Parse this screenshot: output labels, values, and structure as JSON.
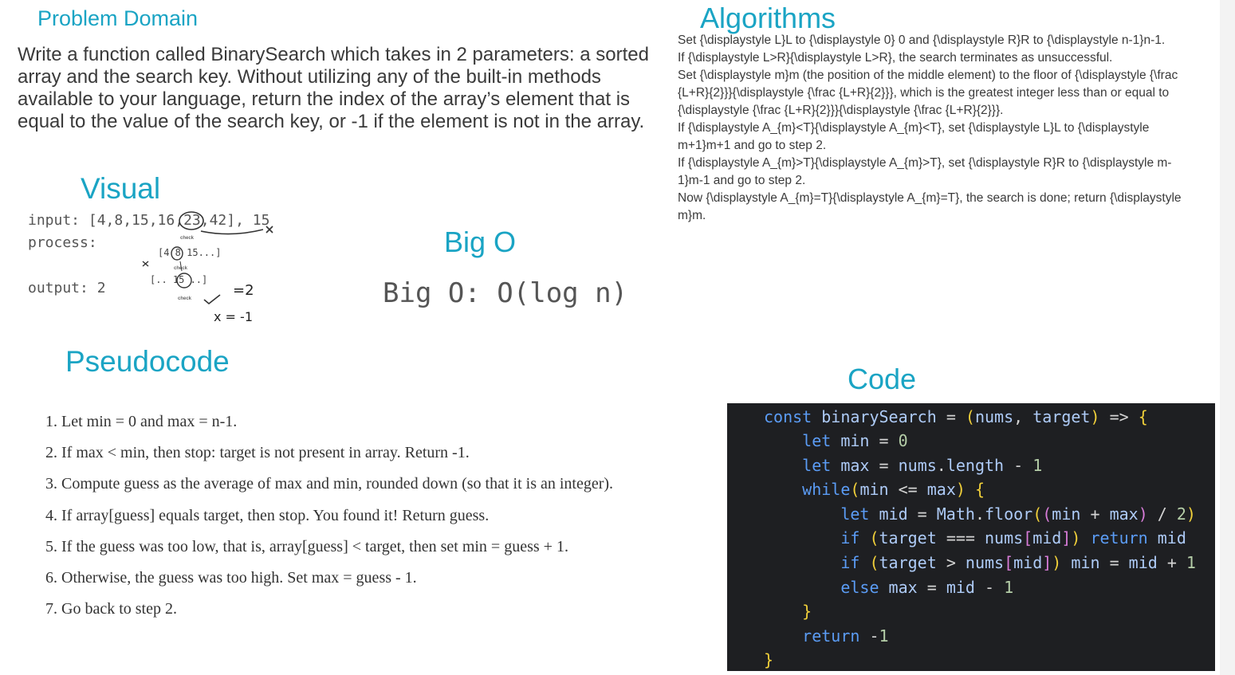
{
  "problem": {
    "heading": "Problem Domain",
    "text": "Write a function called BinarySearch which takes in 2 parameters: a sorted array and the search key. Without utilizing any of the built-in methods available to your language, return the index of the array’s element that is equal to the value of the search key, or -1 if the element is not in the array."
  },
  "algorithms": {
    "heading": "Algorithms",
    "lines": [
      "Set {\\displaystyle L}L to {\\displaystyle 0} 0 and {\\displaystyle R}R to {\\displaystyle n-1}n-1.",
      "If {\\displaystyle L>R}{\\displaystyle L>R}, the search terminates as unsuccessful.",
      "Set {\\displaystyle m}m (the position of the middle element) to the floor of {\\displaystyle {\\frac {L+R}{2}}}{\\displaystyle {\\frac {L+R}{2}}}, which is the greatest integer less than or equal to {\\displaystyle {\\frac {L+R}{2}}}{\\displaystyle {\\frac {L+R}{2}}}.",
      "If {\\displaystyle A_{m}<T}{\\displaystyle A_{m}<T}, set {\\displaystyle L}L to {\\displaystyle m+1}m+1 and go to step 2.",
      "If {\\displaystyle A_{m}>T}{\\displaystyle A_{m}>T}, set {\\displaystyle R}R to {\\displaystyle m-1}m-1 and go to step 2.",
      "Now {\\displaystyle A_{m}=T}{\\displaystyle A_{m}=T}, the search is done; return {\\displaystyle m}m."
    ]
  },
  "visual": {
    "heading": "Visual",
    "input_line": "input: [4,8,15,16,23,42], 15",
    "process_label": "process:",
    "output_line": "output: 2",
    "step1": "[4 8 15...]",
    "step2": "[.. 15 ..]",
    "check_word": "check",
    "result_eq": "=2",
    "result_neg": "x = -1"
  },
  "bigo": {
    "heading": "Big O",
    "text": "Big O: O(log n)"
  },
  "pseudocode": {
    "heading": "Pseudocode",
    "steps": [
      "1. Let min = 0 and max = n-1.",
      "2. If max < min, then stop: target is not present in array. Return -1.",
      "3. Compute guess as the average of max and min, rounded down (so that it is an integer).",
      "4. If array[guess] equals target, then stop. You found it! Return guess.",
      "5. If the guess was too low, that is, array[guess] < target, then set min = guess + 1.",
      "6. Otherwise, the guess was too high. Set max = guess - 1.",
      "7. Go back to step 2."
    ]
  },
  "code": {
    "heading": "Code",
    "lines": [
      "const binarySearch = (nums, target) => {",
      "    let min = 0",
      "    let max = nums.length - 1",
      "    while(min <= max) {",
      "        let mid = Math.floor((min + max) / 2)",
      "        if (target === nums[mid]) return mid",
      "        if (target > nums[mid]) min = mid + 1",
      "        else max = mid - 1",
      "    }",
      "",
      "    return -1",
      "}"
    ]
  }
}
